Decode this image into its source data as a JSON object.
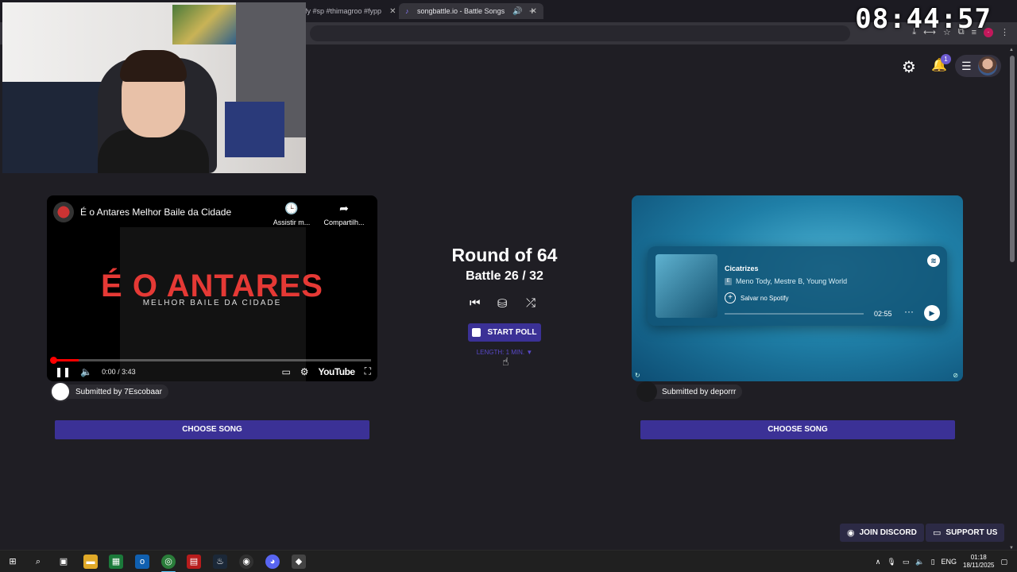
{
  "browser": {
    "tabs": [
      {
        "label": "fy #sp #thimagroo #fypp",
        "active": false
      },
      {
        "label": "songbattle.io - Battle Songs",
        "active": true
      }
    ],
    "new_tab": "+"
  },
  "clock": "08:44:57",
  "header": {
    "settings_icon": "gear-icon",
    "notifications_icon": "bell-icon",
    "notification_count": "1",
    "menu_icon": "hamburger-icon"
  },
  "battle": {
    "round_title": "Round of 64",
    "battle_progress": "Battle 26 / 32",
    "start_poll_label": "START POLL",
    "length_label": "LENGTH: 1 MIN. ▼"
  },
  "left_song": {
    "video_title": "É o Antares Melhor Baile da Cidade",
    "watch_later_label": "Assistir m...",
    "share_label": "Compartilh...",
    "art_title": "É O ANTARES",
    "art_subtitle": "MELHOR BAILE DA CIDADE",
    "time": "0:00 / 3:43",
    "youtube_label": "YouTube",
    "progress": 0.08,
    "submitted_by": "Submitted by 7Escobaar",
    "choose_label": "CHOOSE SONG"
  },
  "right_song": {
    "track": "Cicatrizes",
    "explicit": "E",
    "artists": "Meno Tody, Mestre B, Young World",
    "save_label": "Salvar no Spotify",
    "duration": "02:55",
    "submitted_by": "Submitted by deporrr",
    "choose_label": "CHOOSE SONG"
  },
  "footer": {
    "discord_label": "JOIN DISCORD",
    "support_label": "SUPPORT US"
  },
  "taskbar": {
    "language": "ENG",
    "time": "01:18",
    "date": "18/11/2025"
  },
  "colors": {
    "background": "#1f1e24",
    "accent": "#3b3196",
    "length_text": "#5848c8"
  }
}
